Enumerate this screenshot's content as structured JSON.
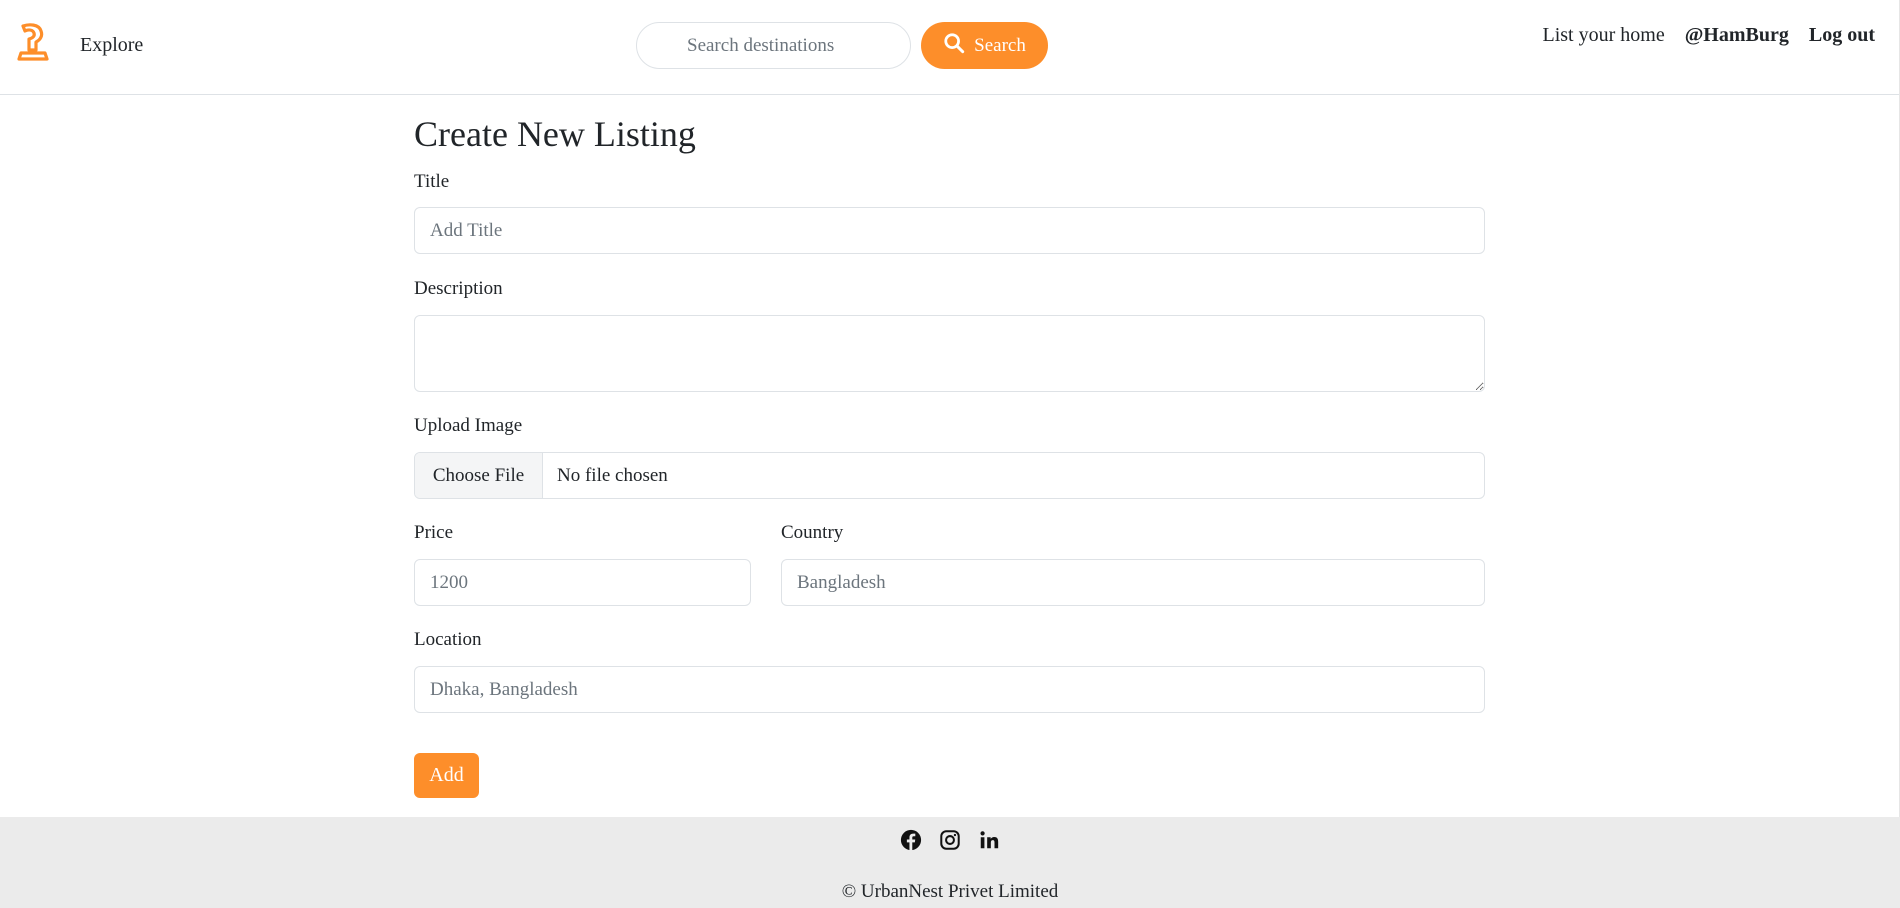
{
  "colors": {
    "accent": "#fd8e2a",
    "footer_bg": "#ebebeb",
    "border": "#dee2e6"
  },
  "navbar": {
    "logo_icon": "urbannest-logo-icon",
    "explore_label": "Explore",
    "search_placeholder": "Search destinations",
    "search_icon": "search-icon",
    "search_button_label": "Search",
    "list_home_label": "List your home",
    "username": "@HamBurg",
    "logout_label": "Log out"
  },
  "form": {
    "title": "Create New Listing",
    "fields": {
      "title": {
        "label": "Title",
        "placeholder": "Add Title",
        "value": ""
      },
      "description": {
        "label": "Description",
        "value": ""
      },
      "image": {
        "label": "Upload Image",
        "button_label": "Choose File",
        "status": "No file chosen"
      },
      "price": {
        "label": "Price",
        "placeholder": "1200",
        "value": ""
      },
      "country": {
        "label": "Country",
        "placeholder": "Bangladesh",
        "value": ""
      },
      "location": {
        "label": "Location",
        "placeholder": "Dhaka, Bangladesh",
        "value": ""
      }
    },
    "submit_label": "Add"
  },
  "footer": {
    "social_icons": [
      "facebook-icon",
      "instagram-icon",
      "linkedin-icon"
    ],
    "copyright": "© UrbanNest Privet Limited"
  }
}
